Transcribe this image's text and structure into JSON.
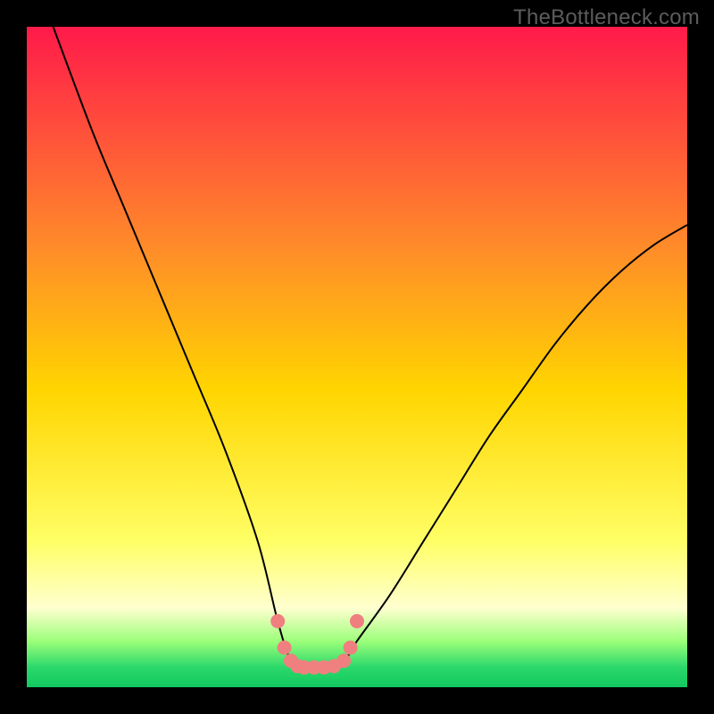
{
  "watermark": "TheBottleneck.com",
  "colors": {
    "top": "#ff1a4a",
    "upper_mid": "#ff8a2a",
    "mid": "#ffd500",
    "lower_mid": "#ffff66",
    "pale": "#ffffd0",
    "green_light": "#9cff7a",
    "green": "#2bd86b",
    "green_deep": "#12c95f",
    "curve": "#000000",
    "marker": "#f08080",
    "bg": "#000000"
  },
  "chart_data": {
    "type": "line",
    "title": "",
    "xlabel": "",
    "ylabel": "",
    "xlim": [
      0,
      100
    ],
    "ylim": [
      0,
      100
    ],
    "series": [
      {
        "name": "bottleneck-curve",
        "x": [
          4,
          10,
          15,
          20,
          25,
          30,
          35,
          38,
          40,
          42,
          45,
          48,
          50,
          55,
          60,
          65,
          70,
          75,
          80,
          85,
          90,
          95,
          100
        ],
        "values": [
          100,
          84,
          72,
          60,
          48,
          36,
          22,
          10,
          4,
          3,
          3,
          4,
          7,
          14,
          22,
          30,
          38,
          45,
          52,
          58,
          63,
          67,
          70
        ]
      }
    ],
    "markers": {
      "name": "optimal-range",
      "points": [
        {
          "x": 38,
          "y": 10
        },
        {
          "x": 39,
          "y": 6
        },
        {
          "x": 40,
          "y": 4
        },
        {
          "x": 41,
          "y": 3.2
        },
        {
          "x": 42,
          "y": 3
        },
        {
          "x": 43.5,
          "y": 3
        },
        {
          "x": 45,
          "y": 3
        },
        {
          "x": 46.5,
          "y": 3.2
        },
        {
          "x": 48,
          "y": 4
        },
        {
          "x": 49,
          "y": 6
        },
        {
          "x": 50,
          "y": 10
        }
      ]
    },
    "gradient_stops": [
      {
        "pos": 0.0,
        "color": "#ff1a4a"
      },
      {
        "pos": 0.33,
        "color": "#ff8a2a"
      },
      {
        "pos": 0.55,
        "color": "#ffd500"
      },
      {
        "pos": 0.78,
        "color": "#ffff66"
      },
      {
        "pos": 0.88,
        "color": "#ffffd0"
      },
      {
        "pos": 0.93,
        "color": "#9cff7a"
      },
      {
        "pos": 0.97,
        "color": "#2bd86b"
      },
      {
        "pos": 1.0,
        "color": "#12c95f"
      }
    ]
  }
}
